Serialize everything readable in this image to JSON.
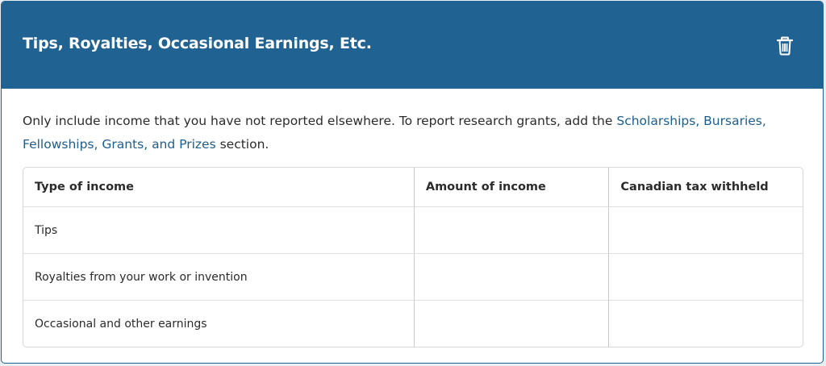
{
  "section": {
    "title": "Tips, Royalties, Occasional Earnings, Etc.",
    "delete_icon": "trash-icon",
    "header_color": "#206392"
  },
  "intro": {
    "text_before": "Only include income that you have not reported elsewhere. To report research grants, add the ",
    "link_text": "Scholarships, Bursaries, Fellowships, Grants, and Prizes",
    "text_after": " section."
  },
  "table": {
    "headers": [
      "Type of income",
      "Amount of income",
      "Canadian tax withheld"
    ],
    "rows": [
      {
        "type": "Tips",
        "amount": "",
        "tax": ""
      },
      {
        "type": "Royalties from your work or invention",
        "amount": "",
        "tax": ""
      },
      {
        "type": "Occasional and other earnings",
        "amount": "",
        "tax": ""
      }
    ]
  }
}
